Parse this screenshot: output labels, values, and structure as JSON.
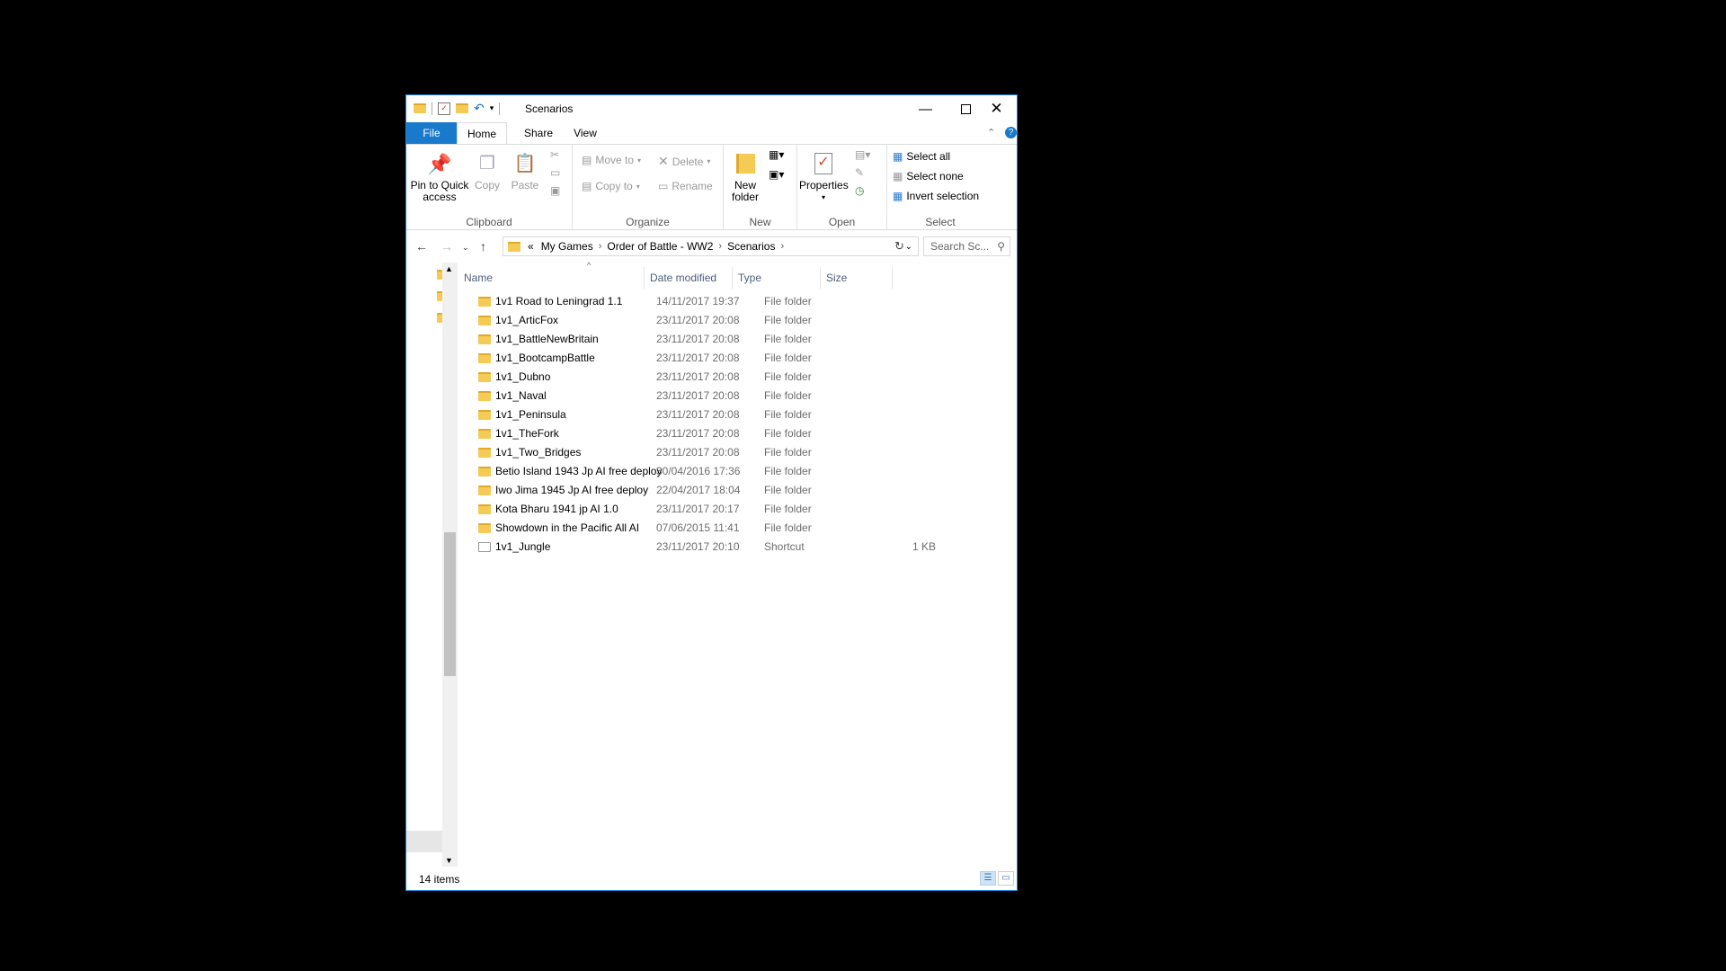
{
  "window": {
    "title": "Scenarios",
    "minimize_icon": "minimize-icon",
    "maximize_icon": "maximize-icon",
    "close_icon": "close-icon"
  },
  "tabs": [
    {
      "label": "File"
    },
    {
      "label": "Home"
    },
    {
      "label": "Share"
    },
    {
      "label": "View"
    }
  ],
  "ribbon": {
    "clipboard": {
      "group_label": "Clipboard",
      "pin_label": "Pin to Quick access",
      "copy_label": "Copy",
      "paste_label": "Paste"
    },
    "organize": {
      "group_label": "Organize",
      "move_to": "Move to",
      "copy_to": "Copy to",
      "delete": "Delete",
      "rename": "Rename"
    },
    "new": {
      "group_label": "New",
      "new_folder": "New folder"
    },
    "open": {
      "group_label": "Open",
      "properties": "Properties"
    },
    "select": {
      "group_label": "Select",
      "select_all": "Select all",
      "select_none": "Select none",
      "invert_selection": "Invert selection"
    }
  },
  "address": {
    "overflow": "«",
    "crumbs": [
      "My Games",
      "Order of Battle - WW2",
      "Scenarios"
    ],
    "search_placeholder": "Search Sc..."
  },
  "columns": {
    "name": "Name",
    "date": "Date modified",
    "type": "Type",
    "size": "Size"
  },
  "files": [
    {
      "name": "1v1 Road to Leningrad 1.1",
      "date": "14/11/2017 19:37",
      "type": "File folder",
      "size": ""
    },
    {
      "name": "1v1_ArticFox",
      "date": "23/11/2017 20:08",
      "type": "File folder",
      "size": ""
    },
    {
      "name": "1v1_BattleNewBritain",
      "date": "23/11/2017 20:08",
      "type": "File folder",
      "size": ""
    },
    {
      "name": "1v1_BootcampBattle",
      "date": "23/11/2017 20:08",
      "type": "File folder",
      "size": ""
    },
    {
      "name": "1v1_Dubno",
      "date": "23/11/2017 20:08",
      "type": "File folder",
      "size": ""
    },
    {
      "name": "1v1_Naval",
      "date": "23/11/2017 20:08",
      "type": "File folder",
      "size": ""
    },
    {
      "name": "1v1_Peninsula",
      "date": "23/11/2017 20:08",
      "type": "File folder",
      "size": ""
    },
    {
      "name": "1v1_TheFork",
      "date": "23/11/2017 20:08",
      "type": "File folder",
      "size": ""
    },
    {
      "name": "1v1_Two_Bridges",
      "date": "23/11/2017 20:08",
      "type": "File folder",
      "size": ""
    },
    {
      "name": "Betio Island 1943 Jp AI free deploy",
      "date": "30/04/2016 17:36",
      "type": "File folder",
      "size": ""
    },
    {
      "name": "Iwo Jima 1945 Jp AI free deploy",
      "date": "22/04/2017 18:04",
      "type": "File folder",
      "size": ""
    },
    {
      "name": "Kota Bharu 1941 jp AI 1.0",
      "date": "23/11/2017 20:17",
      "type": "File folder",
      "size": ""
    },
    {
      "name": "Showdown in the Pacific All AI",
      "date": "07/06/2015 11:41",
      "type": "File folder",
      "size": ""
    },
    {
      "name": "1v1_Jungle",
      "date": "23/11/2017 20:10",
      "type": "Shortcut",
      "size": "1 KB"
    }
  ],
  "status": {
    "item_count": "14 items"
  }
}
